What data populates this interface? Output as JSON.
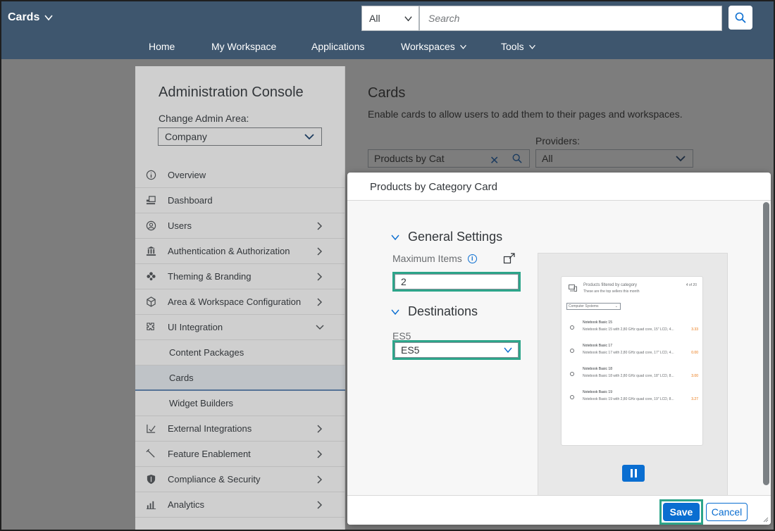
{
  "colors": {
    "shell_bg": "#3e566e",
    "accent": "#0a6ed1",
    "highlight": "#2da58a",
    "overlay": "#7d7d7d"
  },
  "shell": {
    "app_title": "Cards",
    "search_scope": "All",
    "search_placeholder": "Search",
    "nav": [
      "Home",
      "My Workspace",
      "Applications",
      "Workspaces",
      "Tools"
    ]
  },
  "left_panel": {
    "title": "Administration Console",
    "admin_area_label": "Change Admin Area:",
    "admin_area_value": "Company",
    "menu": [
      {
        "label": "Overview",
        "icon": "info-icon"
      },
      {
        "label": "Dashboard",
        "icon": "dashboard-icon"
      },
      {
        "label": "Users",
        "icon": "user-icon"
      },
      {
        "label": "Authentication & Authorization",
        "icon": "building-icon"
      },
      {
        "label": "Theming & Branding",
        "icon": "palette-icon"
      },
      {
        "label": "Area & Workspace Configuration",
        "icon": "cube-icon"
      },
      {
        "label": "UI Integration",
        "icon": "puzzle-icon"
      },
      {
        "label": "Content Packages"
      },
      {
        "label": "Cards"
      },
      {
        "label": "Widget Builders"
      },
      {
        "label": "External Integrations",
        "icon": "checklist-icon"
      },
      {
        "label": "Feature Enablement",
        "icon": "wrench-icon"
      },
      {
        "label": "Compliance & Security",
        "icon": "shield-icon"
      },
      {
        "label": "Analytics",
        "icon": "bar-chart-icon"
      }
    ]
  },
  "content": {
    "title": "Cards",
    "description": "Enable cards to allow users to add them to their pages and workspaces.",
    "filter_value": "Products by Cat",
    "providers_label": "Providers:",
    "providers_value": "All"
  },
  "dialog": {
    "title": "Products by Category Card",
    "general_settings": "General Settings",
    "max_items_label": "Maximum Items",
    "max_items_value": "2",
    "destinations": "Destinations",
    "es5_label": "ES5",
    "es5_value": "ES5",
    "save": "Save",
    "cancel": "Cancel",
    "preview": {
      "title": "Products filtered by category",
      "subtitle": "These are the top sellers this month",
      "count": "4 of 20",
      "select": "Computer Systems",
      "items": [
        {
          "title": "Notebook Basic 15",
          "desc": "Notebook Basic 15 with 2,80 GHz quad core, 15\" LCD, 4...",
          "value": "3.33"
        },
        {
          "title": "Notebook Basic 17",
          "desc": "Notebook Basic 17 with 2,80 GHz quad core, 17\" LCD, 4...",
          "value": "0.00"
        },
        {
          "title": "Notebook Basic 18",
          "desc": "Notebook Basic 18 with 2,80 GHz quad core, 18\" LCD, 8...",
          "value": "3.00"
        },
        {
          "title": "Notebook Basic 19",
          "desc": "Notebook Basic 19 with 2,80 GHz quad core, 19\" LCD, 8...",
          "value": "3.27"
        }
      ]
    }
  }
}
